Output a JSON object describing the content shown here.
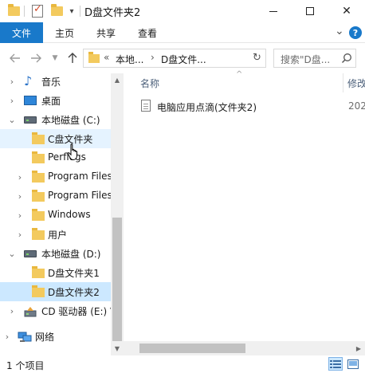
{
  "window": {
    "title": "D盘文件夹2",
    "controls": {
      "minimize": "minimize",
      "maximize": "maximize",
      "close": "✕"
    }
  },
  "ribbon": {
    "tabs": [
      "文件",
      "主页",
      "共享",
      "查看"
    ],
    "expand_glyph": "⌄",
    "help_glyph": "?"
  },
  "address_bar": {
    "prefix": "«",
    "segments": [
      "本地...",
      "D盘文件..."
    ],
    "placeholder": "搜索\"D盘..."
  },
  "nav_pane": {
    "items": [
      {
        "label": "音乐",
        "icon": "music-icon",
        "expandable": true,
        "expanded": false,
        "state": "normal"
      },
      {
        "label": "桌面",
        "icon": "desktop-icon",
        "expandable": true,
        "expanded": false,
        "state": "normal"
      },
      {
        "label": "本地磁盘 (C:)",
        "icon": "drive-icon",
        "expandable": true,
        "expanded": true,
        "state": "normal"
      },
      {
        "label": "C盘文件夹",
        "icon": "folder-icon",
        "expandable": false,
        "expanded": false,
        "state": "hover"
      },
      {
        "label": "Perflogs",
        "icon": "folder-icon",
        "expandable": false,
        "expanded": false,
        "state": "normal"
      },
      {
        "label": "Program Files",
        "icon": "folder-icon",
        "expandable": true,
        "expanded": false,
        "state": "normal"
      },
      {
        "label": "Program Files",
        "icon": "folder-icon",
        "expandable": true,
        "expanded": false,
        "state": "normal"
      },
      {
        "label": "Windows",
        "icon": "folder-icon",
        "expandable": true,
        "expanded": false,
        "state": "normal"
      },
      {
        "label": "用户",
        "icon": "folder-icon",
        "expandable": true,
        "expanded": false,
        "state": "normal"
      },
      {
        "label": "本地磁盘 (D:)",
        "icon": "drive-icon",
        "expandable": true,
        "expanded": true,
        "state": "normal"
      },
      {
        "label": "D盘文件夹1",
        "icon": "folder-icon",
        "expandable": false,
        "expanded": false,
        "state": "normal"
      },
      {
        "label": "D盘文件夹2",
        "icon": "folder-icon",
        "expandable": false,
        "expanded": false,
        "state": "selected"
      },
      {
        "label": "CD 驱动器 (E:) V",
        "icon": "cd-drive-icon",
        "expandable": true,
        "expanded": false,
        "state": "normal"
      },
      {
        "label": "网络",
        "icon": "network-icon",
        "expandable": true,
        "expanded": false,
        "state": "normal"
      }
    ]
  },
  "content": {
    "columns": {
      "name": "名称",
      "modified": "修改"
    },
    "files": [
      {
        "name": "电脑应用点滴(文件夹2)",
        "modified": "202"
      }
    ]
  },
  "status_bar": {
    "item_count": "1 个项目"
  },
  "colors": {
    "accent": "#1979ca",
    "selection": "#cce8ff",
    "hover": "#e5f3ff",
    "folder": "#f3ca5e"
  }
}
